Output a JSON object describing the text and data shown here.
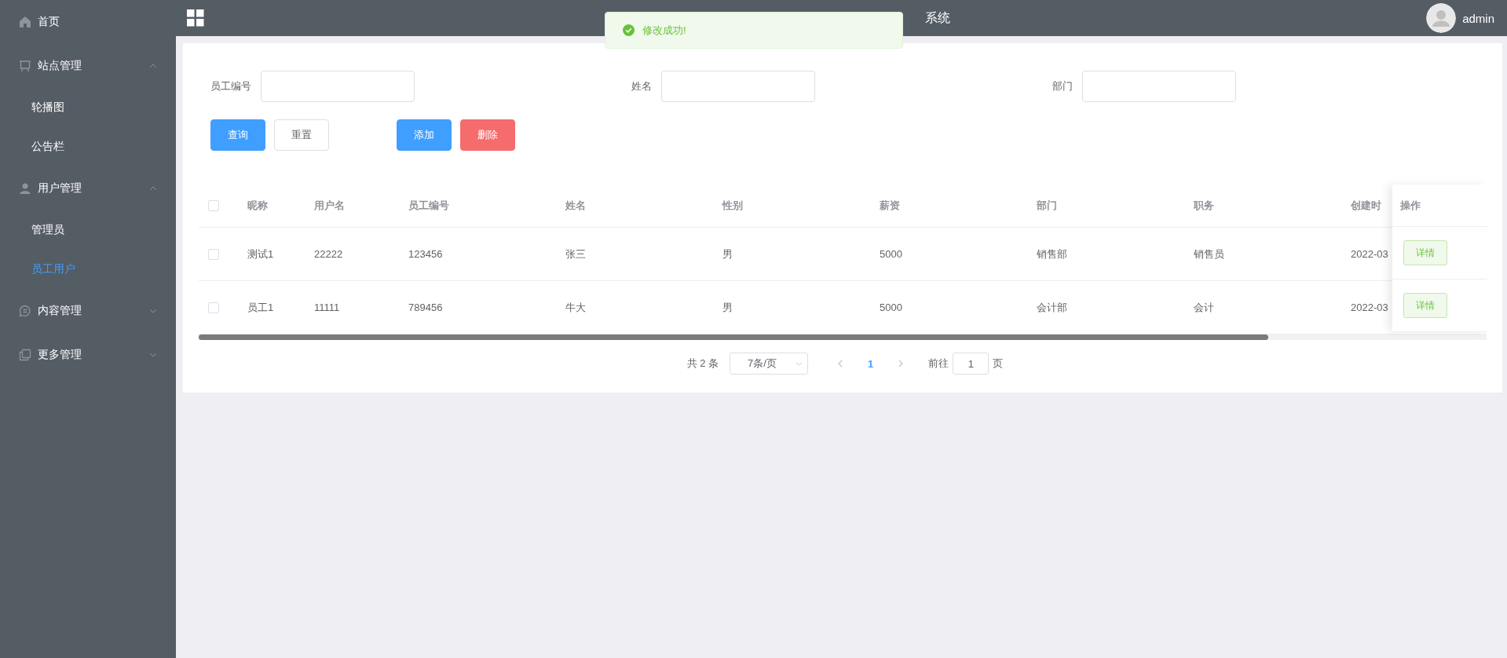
{
  "sidebar": {
    "items": [
      {
        "label": "首页",
        "selected": false
      },
      {
        "label": "站点管理",
        "expanded": true,
        "children": [
          {
            "label": "轮播图",
            "selected": false
          },
          {
            "label": "公告栏",
            "selected": false
          }
        ]
      },
      {
        "label": "用户管理",
        "expanded": true,
        "children": [
          {
            "label": "管理员",
            "selected": false
          },
          {
            "label": "员工用户",
            "selected": true
          }
        ]
      },
      {
        "label": "内容管理",
        "expanded": false
      },
      {
        "label": "更多管理",
        "expanded": false
      }
    ]
  },
  "header": {
    "title_visible_part": "系统",
    "user": "admin"
  },
  "toast": {
    "message": "修改成功!"
  },
  "filters": [
    {
      "label": "员工编号"
    },
    {
      "label": "姓名"
    },
    {
      "label": "部门"
    }
  ],
  "buttons": [
    {
      "label": "查询",
      "kind": "primary"
    },
    {
      "label": "重置",
      "kind": "plain"
    },
    {
      "label": "添加",
      "kind": "primary"
    },
    {
      "label": "删除",
      "kind": "danger"
    }
  ],
  "table": {
    "select_all_checked": false,
    "columns": [
      "昵称",
      "用户名",
      "员工编号",
      "姓名",
      "性别",
      "薪资",
      "部门",
      "职务",
      "创建时"
    ],
    "action_column": "操作",
    "rows": [
      {
        "checked": false,
        "cells": [
          "测试1",
          "22222",
          "123456",
          "张三",
          "男",
          "5000",
          "销售部",
          "销售员",
          "2022-03"
        ],
        "action": "详情"
      },
      {
        "checked": false,
        "cells": [
          "员工1",
          "11111",
          "789456",
          "牛大",
          "男",
          "5000",
          "会计部",
          "会计",
          "2022-03"
        ],
        "action": "详情"
      }
    ]
  },
  "pagination": {
    "total": "共 2 条",
    "page_size": "7条/页",
    "pages": [
      {
        "label": "1",
        "selected": true
      }
    ],
    "goto_label": "前往",
    "goto_value": "1",
    "goto_suffix": "页"
  }
}
